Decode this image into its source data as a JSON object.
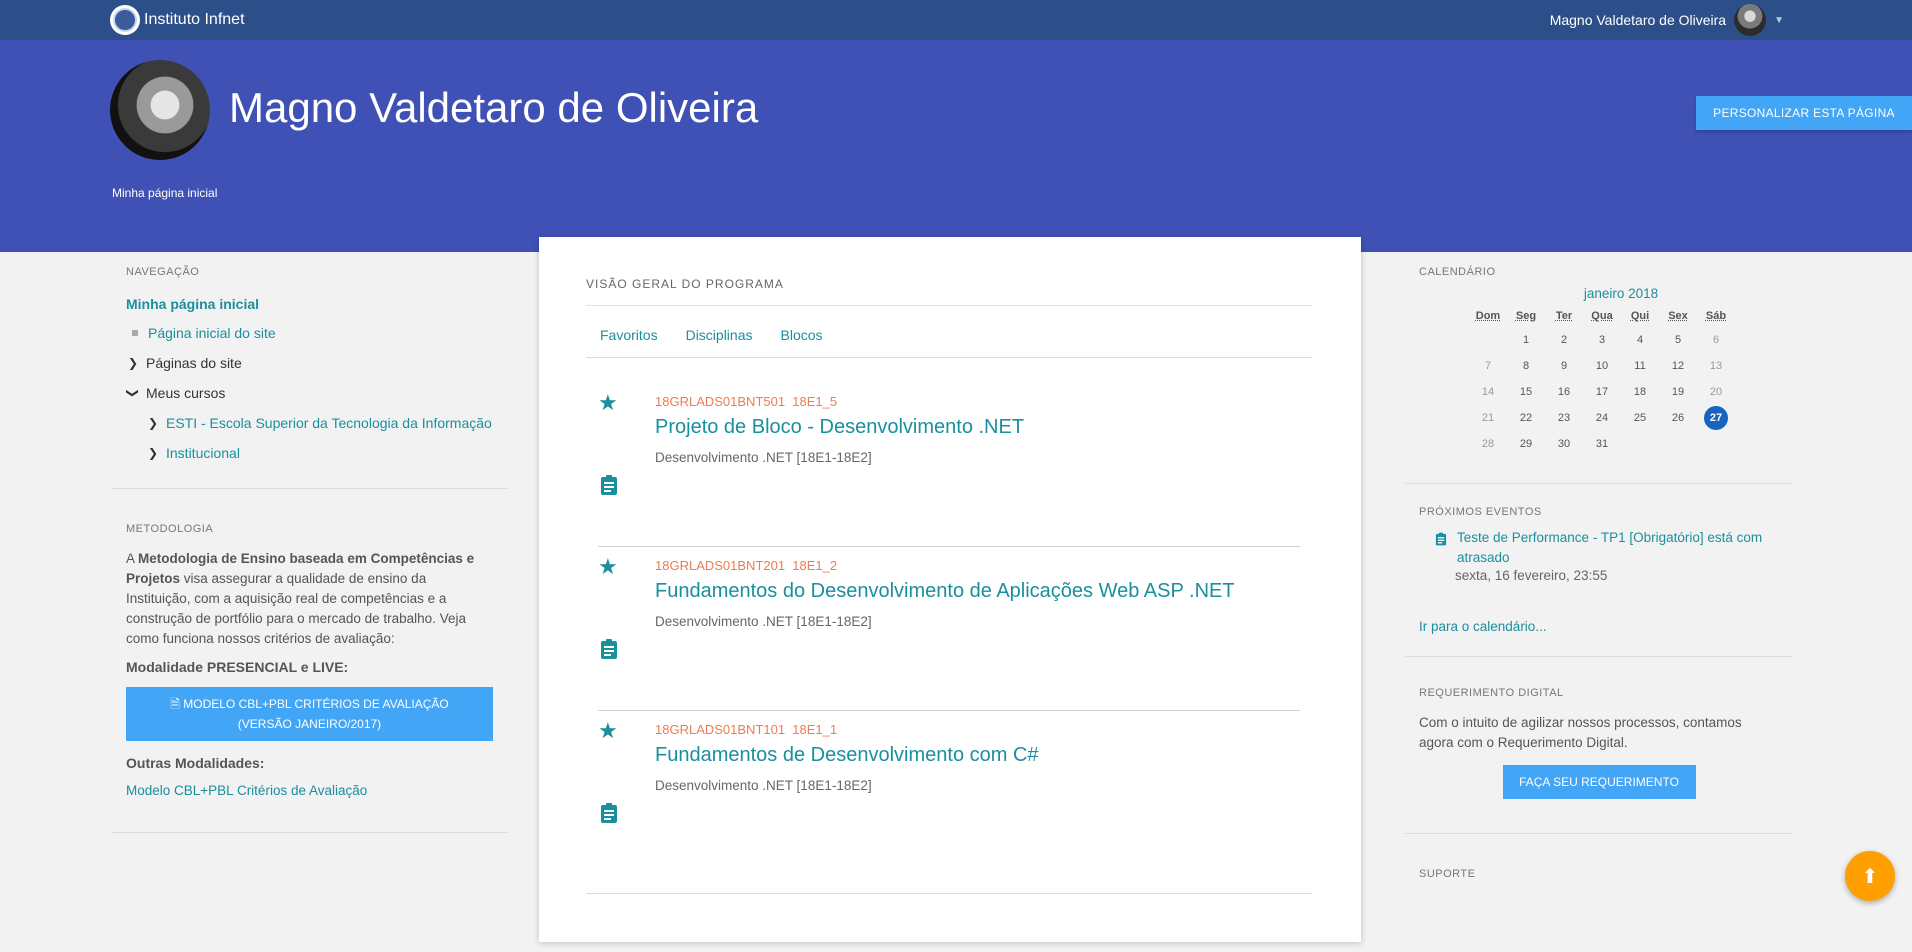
{
  "navbar": {
    "brand": "Instituto Infnet",
    "user_name": "Magno Valdetaro de Oliveira"
  },
  "header": {
    "title": "Magno Valdetaro de Oliveira",
    "breadcrumb": "Minha página inicial",
    "customize_label": "PERSONALIZAR ESTA PÁGINA"
  },
  "navigation": {
    "title": "NAVEGAÇÃO",
    "home": "Minha página inicial",
    "site_home": "Página inicial do site",
    "site_pages": "Páginas do site",
    "my_courses": "Meus cursos",
    "course_categories": [
      "ESTI - Escola Superior da Tecnologia da Informação",
      "Institucional"
    ]
  },
  "methodology": {
    "title": "METODOLOGIA",
    "intro": "A",
    "bold": "Metodologia de Ensino baseada em Competências e Projetos",
    "text": "visa assegurar a qualidade de ensino da Instituição, com a aquisição real de competências e a construção de portfólio para o mercado de trabalho. Veja como funciona nossos critérios de avaliação:",
    "modality_label": "Modalidade PRESENCIAL e LIVE:",
    "button_line1": "MODELO CBL+PBL CRITÉRIOS DE AVALIAÇÃO",
    "button_line2": "(VERSÃO JANEIRO/2017)",
    "other_label": "Outras Modalidades:",
    "other_link": "Modelo CBL+PBL Critérios de Avaliação"
  },
  "overview": {
    "title": "VISÃO GERAL DO PROGRAMA",
    "tabs": [
      "Favoritos",
      "Disciplinas",
      "Blocos"
    ],
    "courses": [
      {
        "code": "18GRLADS01BNT501  18E1_5",
        "name": "Projeto de Bloco - Desenvolvimento .NET",
        "category": "Desenvolvimento .NET [18E1-18E2]"
      },
      {
        "code": "18GRLADS01BNT201  18E1_2",
        "name": "Fundamentos do Desenvolvimento de Aplicações Web ASP .NET",
        "category": "Desenvolvimento .NET [18E1-18E2]"
      },
      {
        "code": "18GRLADS01BNT101  18E1_1",
        "name": "Fundamentos de Desenvolvimento com C#",
        "category": "Desenvolvimento .NET [18E1-18E2]"
      }
    ]
  },
  "calendar": {
    "title": "CALENDÁRIO",
    "month": "janeiro 2018",
    "weekdays": [
      "Dom",
      "Seg",
      "Ter",
      "Qua",
      "Qui",
      "Sex",
      "Sáb"
    ],
    "weeks": [
      [
        "",
        "1",
        "2",
        "3",
        "4",
        "5",
        "6"
      ],
      [
        "7",
        "8",
        "9",
        "10",
        "11",
        "12",
        "13"
      ],
      [
        "14",
        "15",
        "16",
        "17",
        "18",
        "19",
        "20"
      ],
      [
        "21",
        "22",
        "23",
        "24",
        "25",
        "26",
        "27"
      ],
      [
        "28",
        "29",
        "30",
        "31",
        "",
        "",
        ""
      ]
    ],
    "today": "27"
  },
  "events": {
    "title": "PRÓXIMOS EVENTOS",
    "items": [
      {
        "name": "Teste de Performance - TP1 [Obrigatório] está com atrasado",
        "date": "sexta, 16 fevereiro, 23:55"
      }
    ],
    "calendar_link": "Ir para o calendário..."
  },
  "requirement": {
    "title": "REQUERIMENTO DIGITAL",
    "text": "Com o intuito de agilizar nossos processos, contamos agora com o Requerimento Digital.",
    "button": "FAÇA SEU REQUERIMENTO"
  },
  "support": {
    "title": "SUPORTE"
  },
  "colors": {
    "navbar": "#2c4f8a",
    "header": "#3f51b5",
    "accent": "#1a8f9e",
    "button": "#42a5f5",
    "code": "#ef7b4f",
    "fab": "#ffa000"
  }
}
